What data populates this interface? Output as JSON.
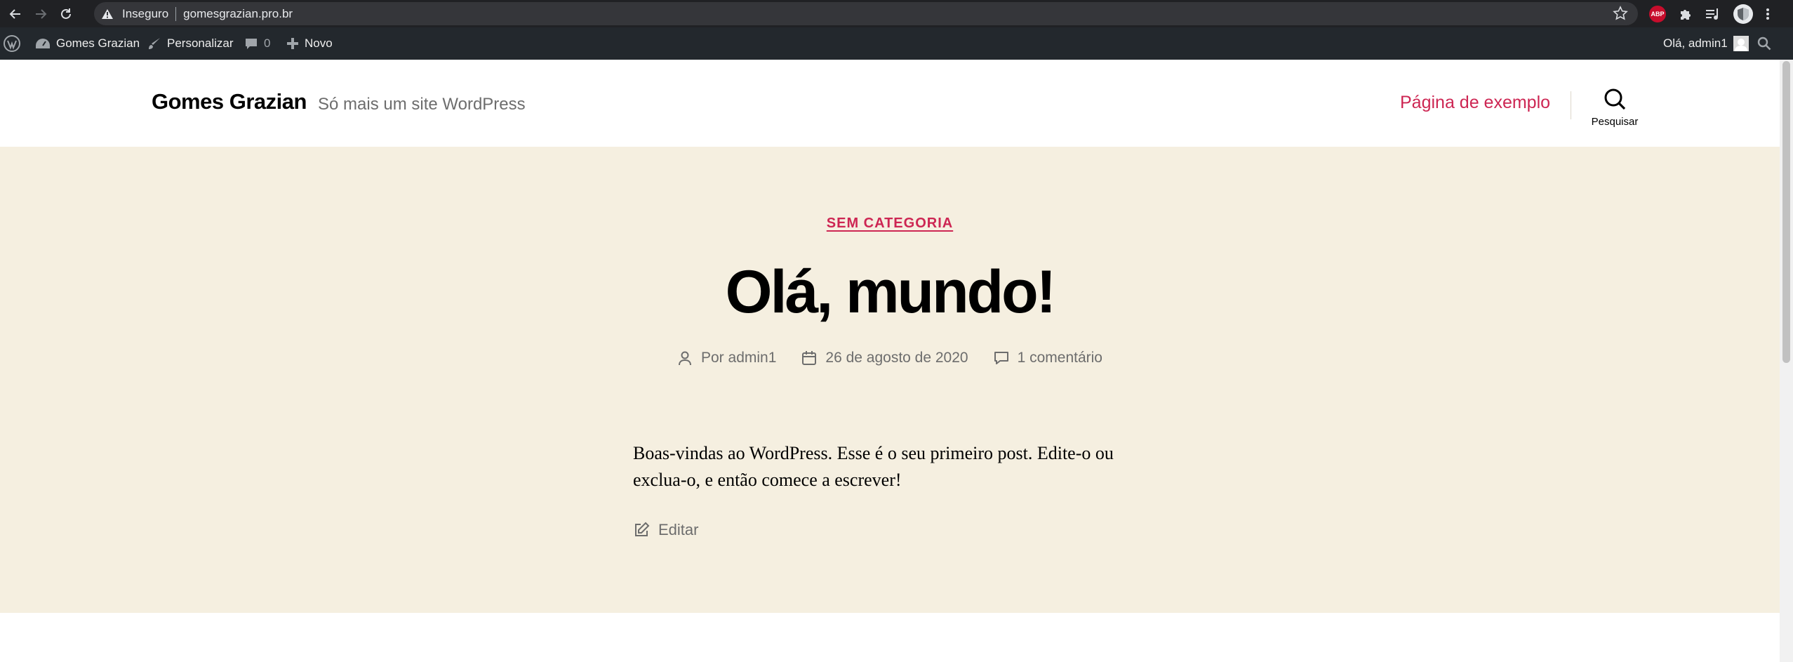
{
  "browser": {
    "security_label": "Inseguro",
    "url": "gomesgrazian.pro.br",
    "abp_label": "ABP"
  },
  "adminbar": {
    "site_name": "Gomes Grazian",
    "customize": "Personalizar",
    "comments_count": "0",
    "new": "Novo",
    "greeting": "Olá, admin1"
  },
  "header": {
    "site_title": "Gomes Grazian",
    "site_description": "Só mais um site WordPress",
    "menu_item": "Página de exemplo",
    "search_label": "Pesquisar"
  },
  "post": {
    "category": "SEM CATEGORIA",
    "title": "Olá, mundo!",
    "author": "Por admin1",
    "date": "26 de agosto de 2020",
    "comments": "1 comentário",
    "content": "Boas-vindas ao WordPress. Esse é o seu primeiro post. Edite-o ou exclua-o, e então comece a escrever!",
    "edit": "Editar"
  },
  "colors": {
    "accent": "#cd2653",
    "hero_bg": "#f5efe0",
    "adminbar_bg": "#23282d",
    "chrome_bg": "#202124"
  }
}
